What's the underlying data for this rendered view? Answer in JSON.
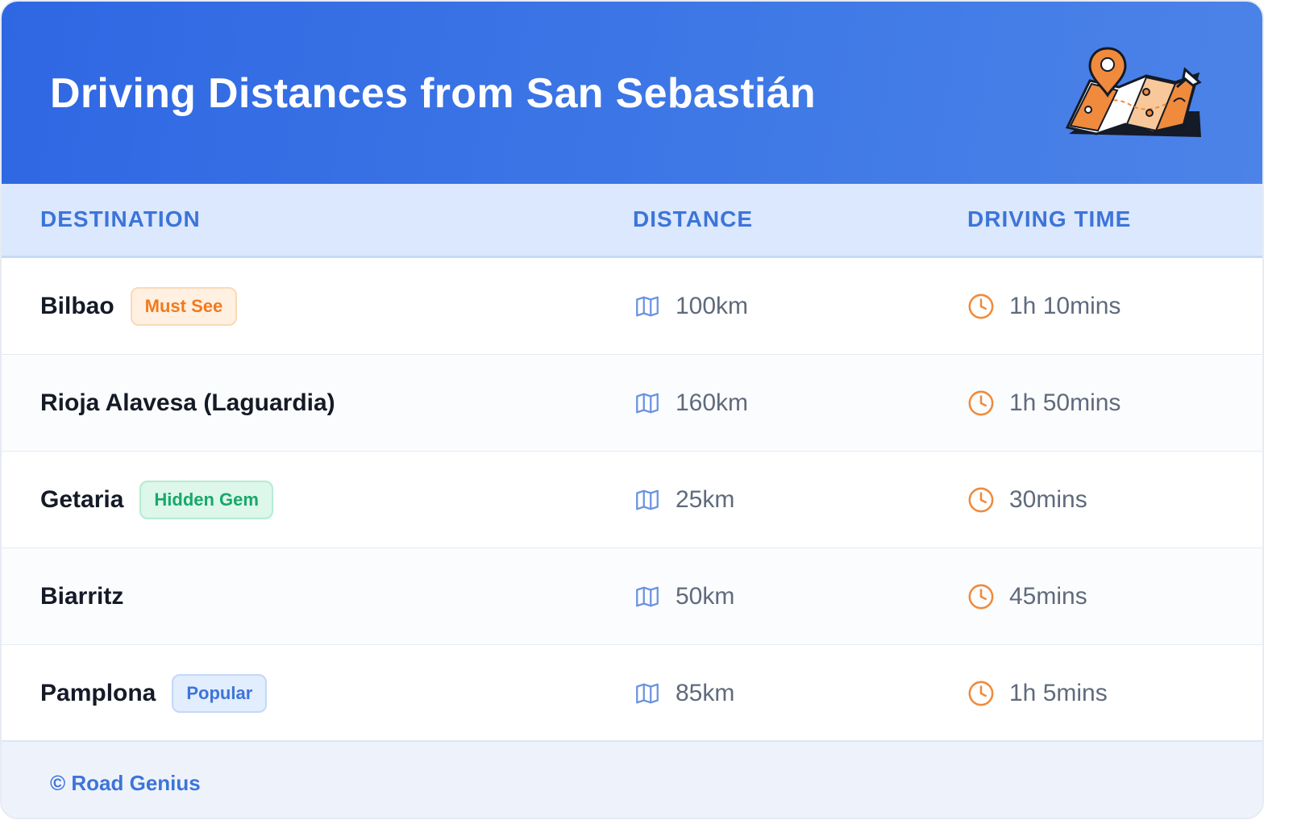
{
  "header": {
    "title": "Driving Distances from San Sebastián",
    "illustration_icon": "map-pin-icon"
  },
  "columns": {
    "destination": "DESTINATION",
    "distance": "DISTANCE",
    "time": "DRIVING TIME"
  },
  "rows": [
    {
      "name": "Bilbao",
      "badge": "Must See",
      "distance": "100km",
      "time": "1h 10mins"
    },
    {
      "name": "Rioja Alavesa (Laguardia)",
      "badge": "",
      "distance": "160km",
      "time": "1h 50mins"
    },
    {
      "name": "Getaria",
      "badge": "Hidden Gem",
      "distance": "25km",
      "time": "30mins"
    },
    {
      "name": "Biarritz",
      "badge": "",
      "distance": "50km",
      "time": "45mins"
    },
    {
      "name": "Pamplona",
      "badge": "Popular",
      "distance": "85km",
      "time": "1h 5mins"
    }
  ],
  "icons": {
    "distance": "map-icon",
    "time": "clock-icon"
  },
  "colors": {
    "header": "#2f67e3",
    "accent_blue": "#3d74d9",
    "badge_orange": "#f07a1e",
    "badge_green": "#17a86a",
    "clock_orange": "#f08a3c"
  },
  "footer": {
    "text": "© Road Genius"
  }
}
